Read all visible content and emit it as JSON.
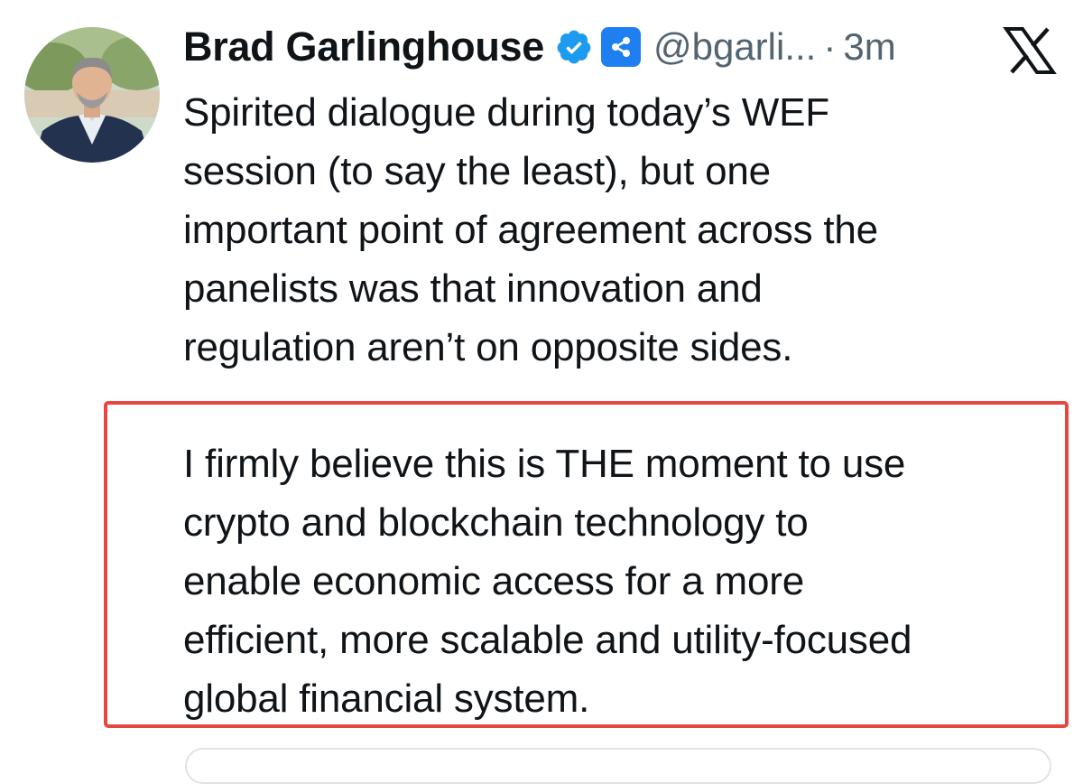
{
  "author": {
    "name": "Brad Garlinghouse",
    "handle": "@bgarli...",
    "separator": "·",
    "time": "3m",
    "avatar_icon": "avatar-photo",
    "verified_icon": "verified-badge-icon",
    "affiliation_icon": "ripple-affiliation-icon"
  },
  "tweet": {
    "paragraph_1": "Spirited dialogue during today’s WEF\nsession (to say the least), but one\nimportant point of agreement across the\npanelists was that innovation and\nregulation aren’t on opposite sides.",
    "paragraph_2": "I firmly believe this is THE moment to use\ncrypto and blockchain technology to\nenable economic access for a more\nefficient, more scalable and utility-focused\nglobal financial system."
  },
  "colors": {
    "highlight_border": "#e8473f",
    "verified_blue": "#1d9bf0",
    "affiliation_blue": "#1d7ff0",
    "secondary_text": "#536471",
    "primary_text": "#0f1419"
  },
  "platform_icon": "x-logo-icon"
}
